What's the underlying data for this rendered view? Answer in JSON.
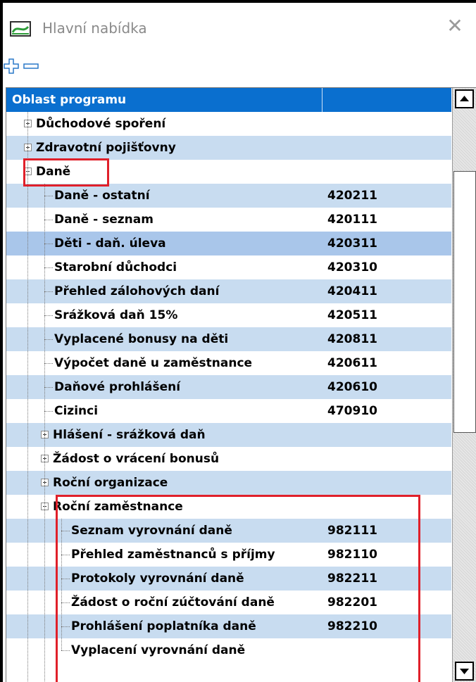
{
  "window": {
    "title": "Hlavní nabídka",
    "close_glyph": "✕"
  },
  "toolbar": {
    "expand_icon": "plus-icon",
    "collapse_icon": "minus-icon"
  },
  "grid": {
    "columns": [
      "Oblast programu",
      ""
    ],
    "rows": [
      {
        "label": "Důchodové spoření",
        "code": ""
      },
      {
        "label": "Zdravotní pojišťovny",
        "code": ""
      },
      {
        "label": "Daně",
        "code": ""
      },
      {
        "label": "Daně - ostatní",
        "code": "420211"
      },
      {
        "label": "Daně - seznam",
        "code": "420111"
      },
      {
        "label": "Děti - daň. úleva",
        "code": "420311"
      },
      {
        "label": "Starobní důchodci",
        "code": "420310"
      },
      {
        "label": "Přehled zálohových daní",
        "code": "420411"
      },
      {
        "label": "Srážková daň 15%",
        "code": "420511"
      },
      {
        "label": "Vyplacené bonusy na děti",
        "code": "420811"
      },
      {
        "label": "Výpočet daně u zaměstnance",
        "code": "420611"
      },
      {
        "label": "Daňové prohlášení",
        "code": "420610"
      },
      {
        "label": "Cizinci",
        "code": "470910"
      },
      {
        "label": "Hlášení - srážková daň",
        "code": ""
      },
      {
        "label": "Žádost o vrácení bonusů",
        "code": ""
      },
      {
        "label": "Roční organizace",
        "code": ""
      },
      {
        "label": "Roční zaměstnance",
        "code": ""
      },
      {
        "label": "Seznam vyrovnání daně",
        "code": "982111"
      },
      {
        "label": "Přehled zaměstnanců s příjmy",
        "code": "982110"
      },
      {
        "label": "Protokoly vyrovnání daně",
        "code": "982211"
      },
      {
        "label": "Žádost o roční zúčtování daně",
        "code": "982201"
      },
      {
        "label": "Prohlášení poplatníka daně",
        "code": "982210"
      },
      {
        "label": "Vyplacení vyrovnání daně",
        "code": ""
      }
    ],
    "selected_row": "Děti - daň. úleva"
  },
  "colors": {
    "header": "#0a6fcf",
    "row_alt": "#c8dcf0",
    "selected": "#a9c6ea",
    "highlight": "#e0202a"
  }
}
